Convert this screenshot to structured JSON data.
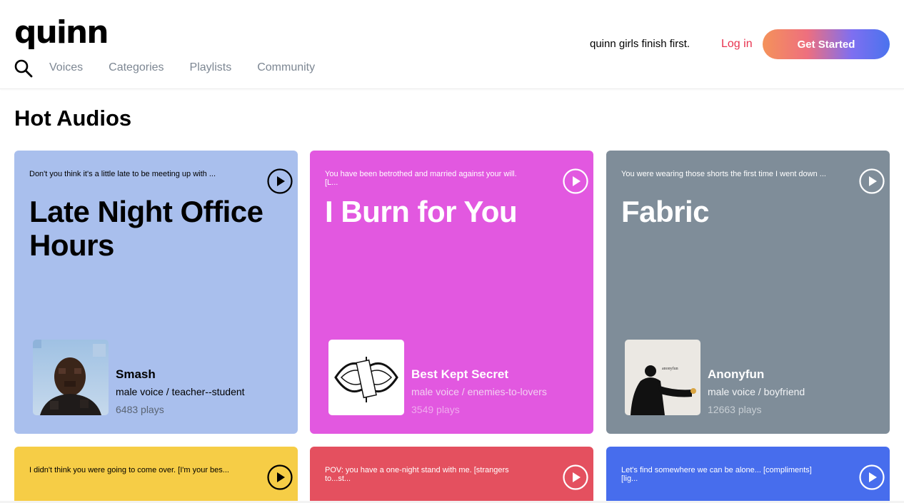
{
  "header": {
    "logo": "quinn",
    "nav": [
      "Voices",
      "Categories",
      "Playlists",
      "Community"
    ],
    "tagline": "quinn girls finish first.",
    "login_label": "Log in",
    "cta_label": "Get Started",
    "icons": {
      "search": "search-icon"
    }
  },
  "section": {
    "title": "Hot Audios"
  },
  "cards": [
    {
      "blurb": "Don't you think it's a little late to be meeting up with ...",
      "title": "Late Night Office Hours",
      "creator": "Smash",
      "voice": "male voice / teacher--student",
      "plays": "6483 plays",
      "color": "#a9bfed"
    },
    {
      "blurb": "You have been betrothed and married against your will. [L...",
      "title": "I Burn for You",
      "creator": "Best Kept Secret",
      "voice": "male voice / enemies-to-lovers",
      "plays": "3549 plays",
      "color": "#e258e0"
    },
    {
      "blurb": "You were wearing those shorts the first time I went down ...",
      "title": "Fabric",
      "creator": "Anonyfun",
      "voice": "male voice / boyfriend",
      "plays": "12663 plays",
      "color": "#7f8d99",
      "avatar_text": "anonyfun"
    },
    {
      "blurb": "I didn't think you were going to come over. [I'm your bes...",
      "color": "#f6cd46"
    },
    {
      "blurb": "POV: you have a one-night stand with me. [strangers to...st...",
      "color": "#e4505f"
    },
    {
      "blurb": "Let's find somewhere we can be alone... [compliments][lig...",
      "color": "#476ded"
    }
  ]
}
